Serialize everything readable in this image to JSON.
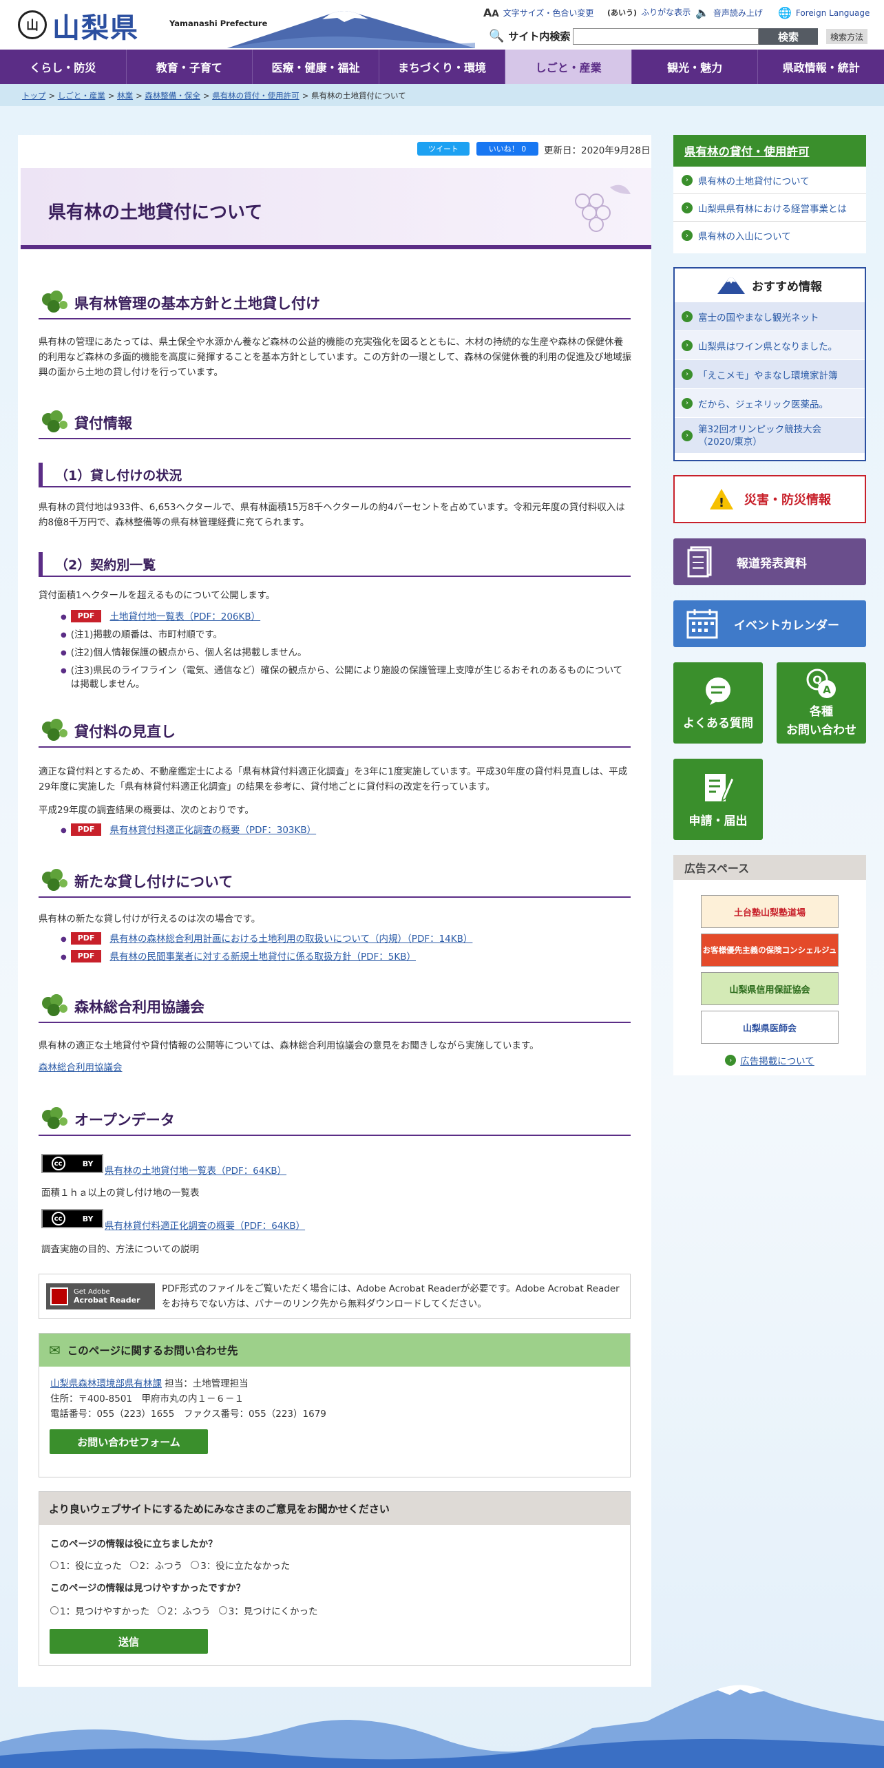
{
  "header": {
    "logo_mark": "山",
    "logo_text": "山梨県",
    "logo_en": "Yamanashi Prefecture",
    "util": [
      {
        "icon": "text-size-icon",
        "glyph": "AA",
        "label": "文字サイズ・色合い変更"
      },
      {
        "icon": "furigana-icon",
        "glyph": "(あいう)",
        "label": "ふりがな表示"
      },
      {
        "icon": "speaker-icon",
        "glyph": "🔈",
        "label": "音声読み上げ"
      },
      {
        "icon": "globe-icon",
        "glyph": "🌐",
        "label": "Foreign Language"
      }
    ],
    "search_label": "サイト内検索",
    "search_value": "",
    "search_button": "検索",
    "search_help": "検索方法"
  },
  "nav": [
    {
      "label": "くらし・防災",
      "active": false
    },
    {
      "label": "教育・子育て",
      "active": false
    },
    {
      "label": "医療・健康・福祉",
      "active": false
    },
    {
      "label": "まちづくり・環境",
      "active": false
    },
    {
      "label": "しごと・産業",
      "active": true
    },
    {
      "label": "観光・魅力",
      "active": false
    },
    {
      "label": "県政情報・統計",
      "active": false
    }
  ],
  "breadcrumb": [
    "トップ",
    "しごと・産業",
    "林業",
    "森林整備・保全",
    "県有林の貸付・使用許可"
  ],
  "breadcrumb_current": "県有林の土地貸付について",
  "social": {
    "tweet": "ツイート",
    "like": "いいね！ 0"
  },
  "updated": "更新日：2020年9月28日",
  "page_title": "県有林の土地貸付について",
  "sections": {
    "s1_title": "県有林管理の基本方針と土地貸し付け",
    "s1_text": "県有林の管理にあたっては、県土保全や水源かん養など森林の公益的機能の充実強化を図るとともに、木材の持続的な生産や森林の保健休養的利用など森林の多面的機能を高度に発揮することを基本方針としています。この方針の一環として、森林の保健休養的利用の促進及び地域振興の面から土地の貸し付けを行っています。",
    "s2_title": "貸付情報",
    "s2_h3a": "（1）貸し付けの状況",
    "s2_texta": "県有林の貸付地は933件、6,653ヘクタールで、県有林面積15万8千ヘクタールの約4パーセントを占めています。令和元年度の貸付料収入は約8億8千万円で、森林整備等の県有林管理経費に充てられます。",
    "s2_h3b": "（2）契約別一覧",
    "s2_textb": "貸付面積1ヘクタールを超えるものについて公開します。",
    "s2_link": "土地貸付地一覧表（PDF：206KB）",
    "s2_note1": "(注1)掲載の順番は、市町村順です。",
    "s2_note2": "(注2)個人情報保護の観点から、個人名は掲載しません。",
    "s2_note3": "(注3)県民のライフライン（電気、通信など）確保の観点から、公開により施設の保護管理上支障が生じるおそれのあるものについては掲載しません。",
    "s3_title": "貸付料の見直し",
    "s3_text": "適正な貸付料とするため、不動産鑑定士による「県有林貸付料適正化調査」を3年に1度実施しています。平成30年度の貸付料見直しは、平成29年度に実施した「県有林貸付料適正化調査」の結果を参考に、貸付地ごとに貸付料の改定を行っています。",
    "s3_text2": "平成29年度の調査結果の概要は、次のとおりです。",
    "s3_link": "県有林貸付料適正化調査の概要（PDF：303KB）",
    "s4_title": "新たな貸し付けについて",
    "s4_text": "県有林の新たな貸し付けが行えるのは次の場合です。",
    "s4_link1": "県有林の森林総合利用計画における土地利用の取扱いについて（内規）（PDF：14KB）",
    "s4_link2": "県有林の民間事業者に対する新規土地貸付に係る取扱方針（PDF：5KB）",
    "s5_title": "森林総合利用協議会",
    "s5_text": "県有林の適正な土地貸付や貸付情報の公開等については、森林総合利用協議会の意見をお聞きしながら実施しています。",
    "s5_link": "森林総合利用協議会",
    "s6_title": "オープンデータ",
    "s6_link1": "県有林の土地貸付地一覧表（PDF：64KB）",
    "s6_desc1": "面積１ｈａ以上の貸し付け地の一覧表",
    "s6_link2": "県有林貸付料適正化調査の概要（PDF：64KB）",
    "s6_desc2": "調査実施の目的、方法についての説明",
    "pdf_badge": "PDF",
    "cc_label": "cc",
    "cc_by": "BY"
  },
  "adobe": {
    "banner_line1": "Get Adobe",
    "banner_line2": "Acrobat Reader",
    "text": "PDF形式のファイルをご覧いただく場合には、Adobe Acrobat Readerが必要です。Adobe Acrobat Readerをお持ちでない方は、バナーのリンク先から無料ダウンロードしてください。"
  },
  "contact": {
    "title": "このページに関するお問い合わせ先",
    "dept_link": "山梨県森林環境部県有林課",
    "dept_rest": " 担当：土地管理担当",
    "address": "住所：〒400-8501　甲府市丸の内１－６－１",
    "phone": "電話番号：055（223）1655　ファクス番号：055（223）1679",
    "button": "お問い合わせフォーム"
  },
  "survey": {
    "title": "より良いウェブサイトにするためにみなさまのご意見をお聞かせください",
    "q1": "このページの情報は役に立ちましたか？",
    "q1_opts": [
      "1：役に立った",
      "2：ふつう",
      "3：役に立たなかった"
    ],
    "q2": "このページの情報は見つけやすかったですか？",
    "q2_opts": [
      "1：見つけやすかった",
      "2：ふつう",
      "3：見つけにくかった"
    ],
    "submit": "送信"
  },
  "sidebar": {
    "box_title": "県有林の貸付・使用許可",
    "box_items": [
      "県有林の土地貸付について",
      "山梨県県有林における経営事業とは",
      "県有林の入山について"
    ],
    "rec_title": "おすすめ情報",
    "rec_items": [
      "富士の国やまなし観光ネット",
      "山梨県はワイン県となりました。",
      "「えこメモ」やまなし環境家計簿",
      "だから、ジェネリック医薬品。",
      "第32回オリンピック競技大会（2020/東京）"
    ],
    "disaster": "災害・防災情報",
    "press": "報道発表資料",
    "event": "イベントカレンダー",
    "faq": "よくある質問",
    "inquiry1": "各種",
    "inquiry2": "お問い合わせ",
    "apply": "申請・届出",
    "ad_title": "広告スペース",
    "ads": [
      "土台塾山梨塾道場",
      "お客様優先主義の保険コンシェルジュ",
      "山梨県信用保証協会",
      "山梨県医師会"
    ],
    "ad_link": "広告掲載について"
  },
  "colors": {
    "purple": "#5b2d86",
    "green": "#3a8f2c",
    "red": "#c8202a",
    "blue": "#2b4fa0"
  }
}
